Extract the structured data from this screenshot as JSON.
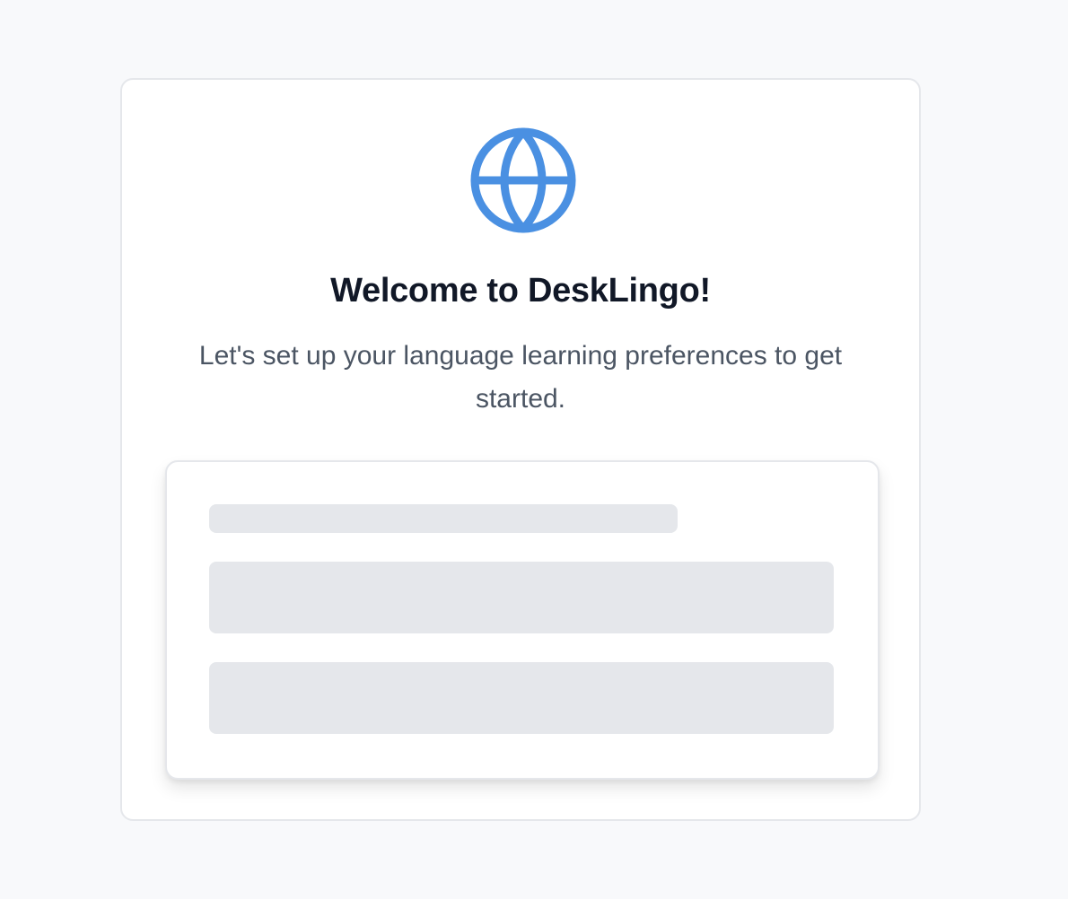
{
  "welcome": {
    "title": "Welcome to DeskLingo!",
    "subtitle": "Let's set up your language learning preferences to get started."
  },
  "icons": {
    "hero": "globe-icon"
  },
  "loading_state": {
    "placeholders": [
      "label-skeleton",
      "field-skeleton",
      "field-skeleton"
    ]
  },
  "colors": {
    "accent": "#4a90e2",
    "background": "#f8f9fb",
    "card": "#ffffff",
    "skeleton": "#e5e7eb",
    "title": "#111827",
    "subtitle": "#4b5563"
  }
}
